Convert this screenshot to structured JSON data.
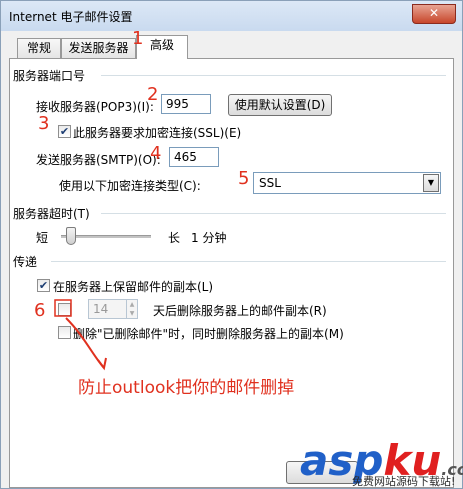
{
  "window": {
    "title": "Internet 电子邮件设置",
    "close_glyph": "✕"
  },
  "tabs": [
    {
      "label": "常规"
    },
    {
      "label": "发送服务器"
    },
    {
      "label": "高级"
    }
  ],
  "ports": {
    "section_label": "服务器端口号",
    "incoming_label": "接收服务器(POP3)(I):",
    "incoming_value": "995",
    "default_button": "使用默认设置(D)",
    "ssl_checkbox_label": "此服务器要求加密连接(SSL)(E)",
    "ssl_checked": true,
    "outgoing_label": "发送服务器(SMTP)(O):",
    "outgoing_value": "465",
    "encryption_label": "使用以下加密连接类型(C):",
    "encryption_value": "SSL"
  },
  "timeout": {
    "section_label": "服务器超时(T)",
    "short_label": "短",
    "long_label": "长",
    "value_text": "1 分钟",
    "level": 0.05
  },
  "delivery": {
    "section_label": "传递",
    "keep_copy_label": "在服务器上保留邮件的副本(L)",
    "keep_copy_checked": true,
    "remove_after_label": "天后删除服务器上的邮件副本(R)",
    "remove_after_checked": false,
    "days_value": "14",
    "remove_deleted_label": "删除\"已删除邮件\"时，同时删除服务器上的副本(M)",
    "remove_deleted_checked": false
  },
  "annotations": {
    "n1": "1",
    "n2": "2",
    "n3": "3",
    "n4": "4",
    "n5": "5",
    "n6": "6",
    "note": "防止outlook把你的邮件删掉",
    "color": "#e0311f"
  },
  "watermark": {
    "brand_a": "asp",
    "brand_b": "ku",
    "brand_c": ".com",
    "tagline": "免费网站源码下载站!"
  },
  "colors": {
    "accent": "#1c3d72",
    "close": "#c7462b",
    "annotation": "#e0311f"
  }
}
